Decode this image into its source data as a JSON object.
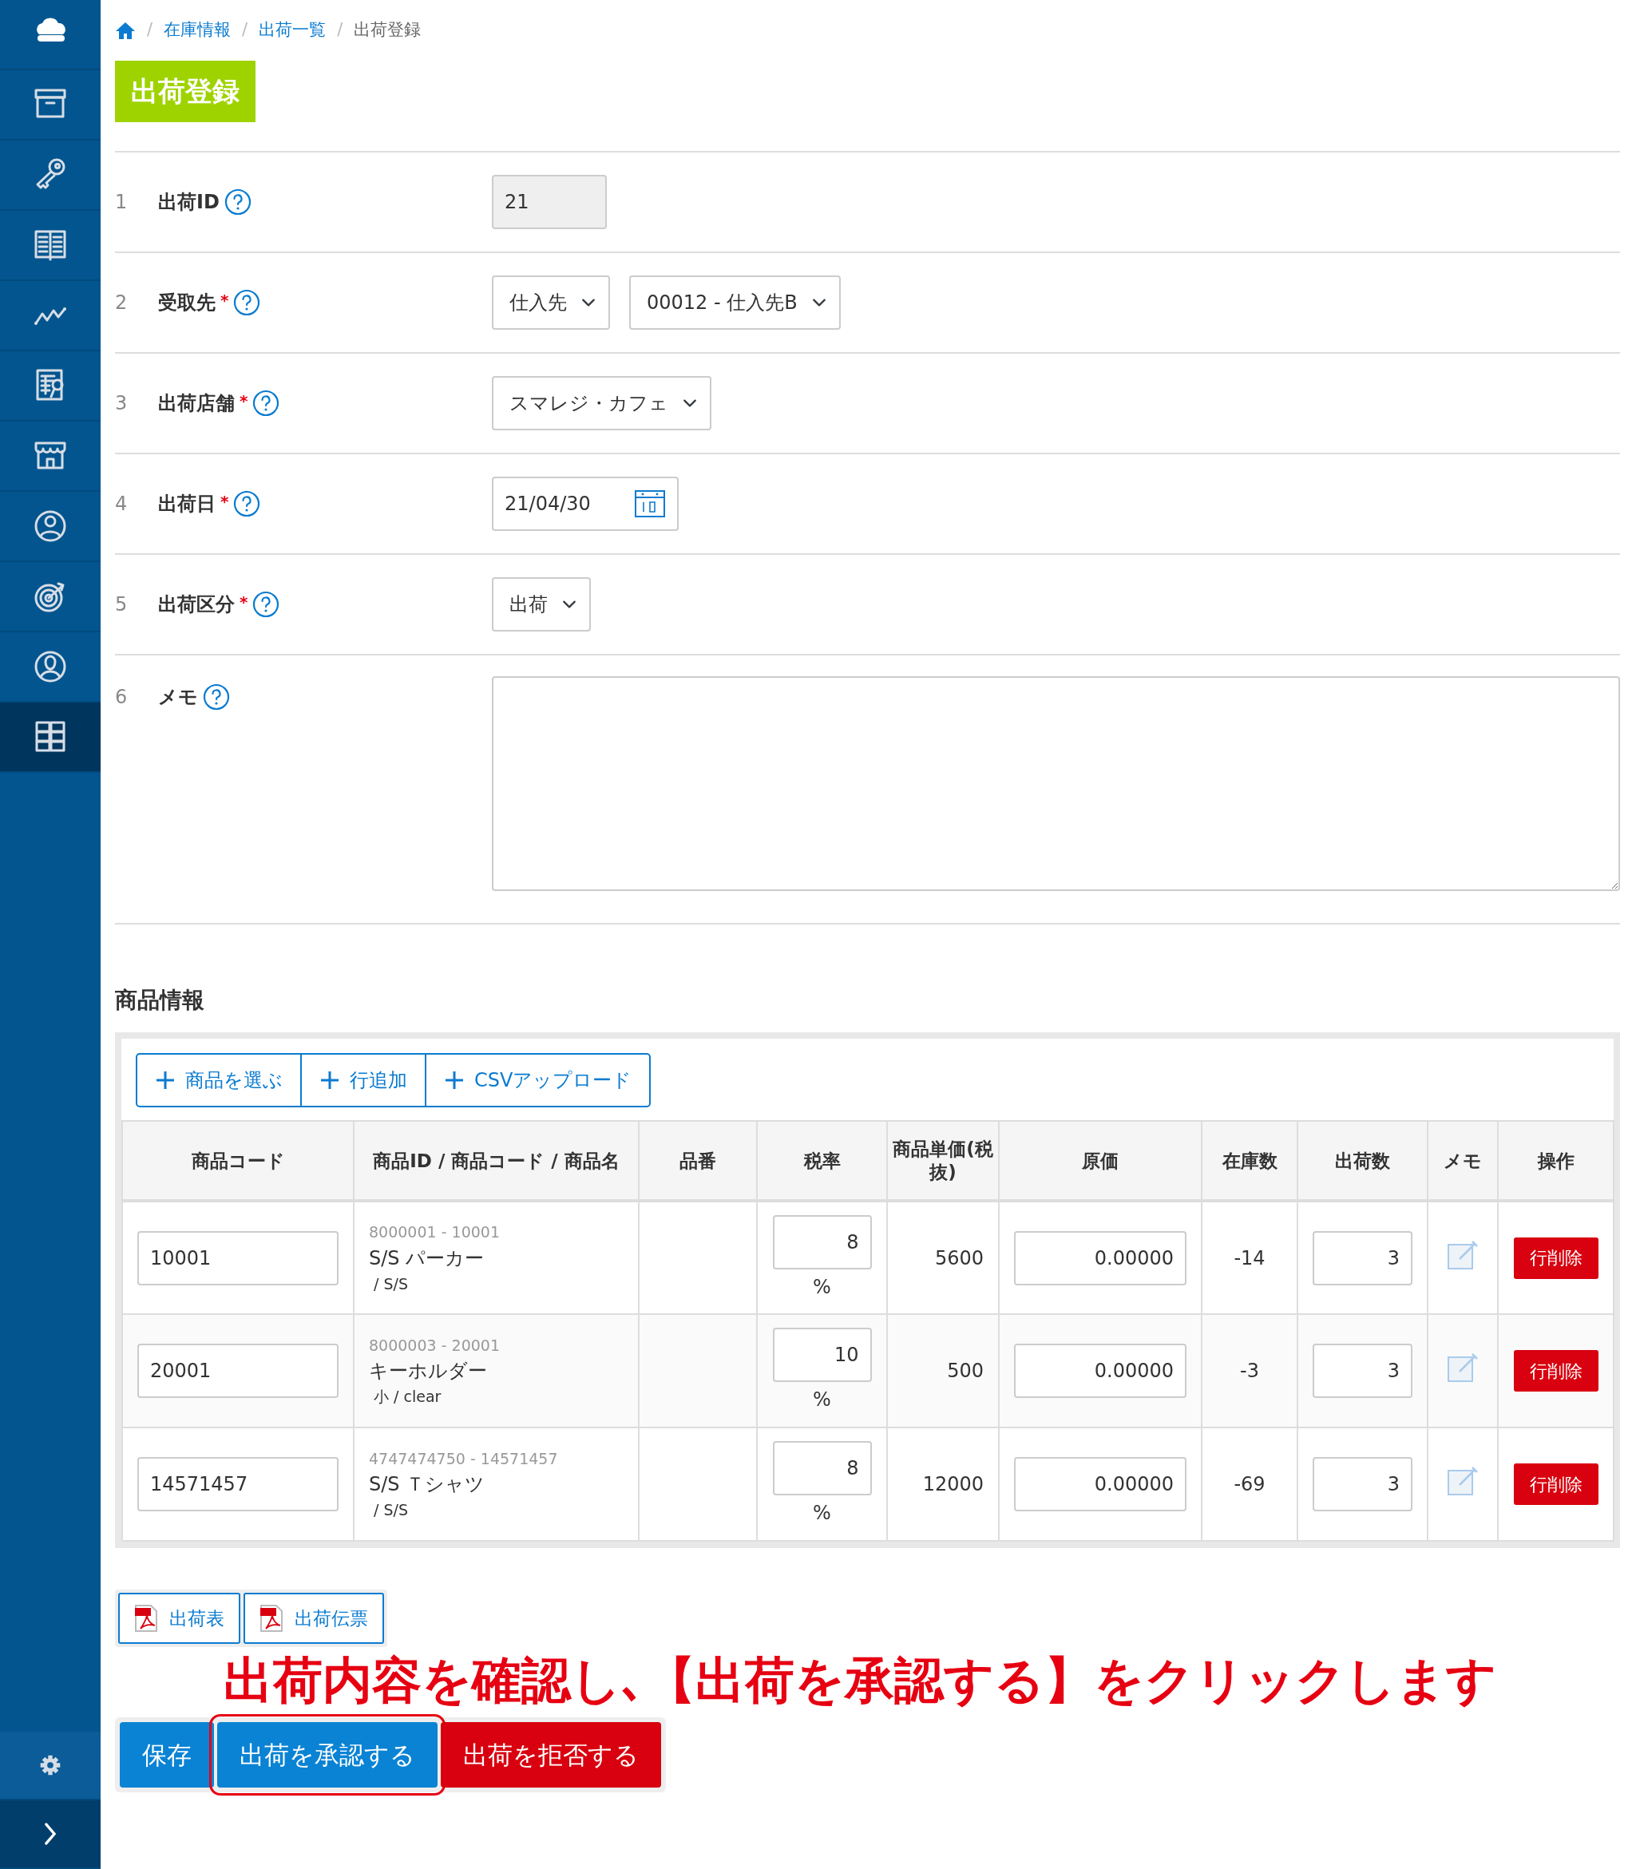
{
  "sidebar": {
    "items": [
      {
        "kind": "cloud",
        "selected": false
      },
      {
        "kind": "box",
        "selected": false
      },
      {
        "kind": "key",
        "selected": false
      },
      {
        "kind": "book",
        "selected": false
      },
      {
        "kind": "chart",
        "selected": false
      },
      {
        "kind": "report",
        "selected": false
      },
      {
        "kind": "store",
        "selected": false
      },
      {
        "kind": "staff",
        "selected": false
      },
      {
        "kind": "target",
        "selected": false
      },
      {
        "kind": "person",
        "selected": false
      },
      {
        "kind": "cabinet",
        "selected": true
      }
    ],
    "footer": [
      {
        "kind": "settings"
      },
      {
        "kind": "expand"
      }
    ]
  },
  "breadcrumb": [
    {
      "kind": "home"
    },
    {
      "kind": "link",
      "separator": "/",
      "label": "在庫情報"
    },
    {
      "kind": "link",
      "separator": "/",
      "label": "出荷一覧"
    },
    {
      "kind": "current",
      "separator": "/",
      "label": "出荷登録"
    }
  ],
  "page_title": "出荷登録",
  "form": [
    {
      "number": "1",
      "label": "出荷ID",
      "controls": [
        {
          "kind": "readonly",
          "value": "21"
        }
      ]
    },
    {
      "number": "2",
      "label": "受取先",
      "mark": "*",
      "controls": [
        {
          "kind": "select",
          "value": "仕入先"
        },
        {
          "kind": "select",
          "value": "00012 - 仕入先B"
        }
      ]
    },
    {
      "number": "3",
      "label": "出荷店舗",
      "mark": "*",
      "controls": [
        {
          "kind": "select",
          "value": "スマレジ・カフェ"
        }
      ]
    },
    {
      "number": "4",
      "label": "出荷日",
      "mark": "*",
      "controls": [
        {
          "kind": "date",
          "value": "21/04/30"
        }
      ]
    },
    {
      "number": "5",
      "label": "出荷区分",
      "mark": "*",
      "controls": [
        {
          "kind": "select",
          "value": "出荷"
        }
      ]
    },
    {
      "number": "6",
      "label": "メモ",
      "controls": [
        {
          "kind": "textarea"
        }
      ]
    }
  ],
  "products": {
    "heading": "商品情報",
    "actions": [
      "商品を選ぶ",
      "行追加",
      "CSVアップロード"
    ],
    "columns": [
      "商品コード",
      "商品ID / 商品コード / 商品名",
      "品番",
      "税率",
      "商品単価(税抜)",
      "原価",
      "在庫数",
      "出荷数",
      "メモ",
      "操作"
    ],
    "rows": [
      {
        "code": "10001",
        "ids": "8000001 - 10001",
        "name": "S/S パーカー",
        "variant": "/ S/S",
        "tax": "8",
        "tax_unit": "%",
        "price": "5600",
        "cost": "0.00000",
        "stock": "-14",
        "quantity": "3",
        "delete": "行削除"
      },
      {
        "code": "20001",
        "ids": "8000003 - 20001",
        "name": "キーホルダー",
        "variant": "小 / clear",
        "tax": "10",
        "tax_unit": "%",
        "price": "500",
        "cost": "0.00000",
        "stock": "-3",
        "quantity": "3",
        "delete": "行削除"
      },
      {
        "code": "14571457",
        "ids": "4747474750 - 14571457",
        "name": "S/S Ｔシャツ",
        "variant": "/ S/S",
        "tax": "8",
        "tax_unit": "%",
        "price": "12000",
        "cost": "0.00000",
        "stock": "-69",
        "quantity": "3",
        "delete": "行削除"
      }
    ]
  },
  "pdf_buttons": [
    "出荷表",
    "出荷伝票"
  ],
  "annotation": "出荷内容を確認し､【出荷を承認する】をクリックします",
  "actions": [
    {
      "kind": "primary",
      "label": "保存",
      "highlighted": false
    },
    {
      "kind": "primary",
      "label": "出荷を承認する",
      "highlighted": true
    },
    {
      "kind": "danger",
      "label": "出荷を拒否する",
      "highlighted": false
    }
  ]
}
